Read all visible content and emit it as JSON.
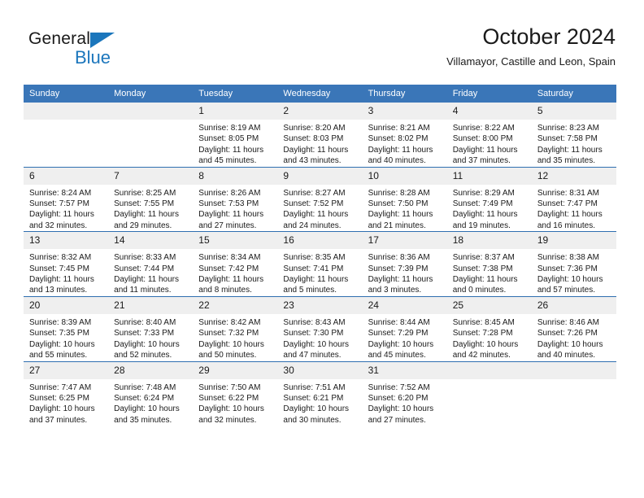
{
  "brand": {
    "name_top": "General",
    "name_bottom": "Blue",
    "accent_color": "#1b76bc"
  },
  "header": {
    "title": "October 2024",
    "subtitle": "Villamayor, Castille and Leon, Spain"
  },
  "calendar": {
    "header_bg": "#3a76b8",
    "daynum_bg": "#efefef",
    "grid_line_color": "#2f6fb0",
    "weekday_headers": [
      "Sunday",
      "Monday",
      "Tuesday",
      "Wednesday",
      "Thursday",
      "Friday",
      "Saturday"
    ],
    "weeks": [
      [
        {
          "day": ""
        },
        {
          "day": ""
        },
        {
          "day": "1",
          "sunrise": "Sunrise: 8:19 AM",
          "sunset": "Sunset: 8:05 PM",
          "daylight_l1": "Daylight: 11 hours",
          "daylight_l2": "and 45 minutes."
        },
        {
          "day": "2",
          "sunrise": "Sunrise: 8:20 AM",
          "sunset": "Sunset: 8:03 PM",
          "daylight_l1": "Daylight: 11 hours",
          "daylight_l2": "and 43 minutes."
        },
        {
          "day": "3",
          "sunrise": "Sunrise: 8:21 AM",
          "sunset": "Sunset: 8:02 PM",
          "daylight_l1": "Daylight: 11 hours",
          "daylight_l2": "and 40 minutes."
        },
        {
          "day": "4",
          "sunrise": "Sunrise: 8:22 AM",
          "sunset": "Sunset: 8:00 PM",
          "daylight_l1": "Daylight: 11 hours",
          "daylight_l2": "and 37 minutes."
        },
        {
          "day": "5",
          "sunrise": "Sunrise: 8:23 AM",
          "sunset": "Sunset: 7:58 PM",
          "daylight_l1": "Daylight: 11 hours",
          "daylight_l2": "and 35 minutes."
        }
      ],
      [
        {
          "day": "6",
          "sunrise": "Sunrise: 8:24 AM",
          "sunset": "Sunset: 7:57 PM",
          "daylight_l1": "Daylight: 11 hours",
          "daylight_l2": "and 32 minutes."
        },
        {
          "day": "7",
          "sunrise": "Sunrise: 8:25 AM",
          "sunset": "Sunset: 7:55 PM",
          "daylight_l1": "Daylight: 11 hours",
          "daylight_l2": "and 29 minutes."
        },
        {
          "day": "8",
          "sunrise": "Sunrise: 8:26 AM",
          "sunset": "Sunset: 7:53 PM",
          "daylight_l1": "Daylight: 11 hours",
          "daylight_l2": "and 27 minutes."
        },
        {
          "day": "9",
          "sunrise": "Sunrise: 8:27 AM",
          "sunset": "Sunset: 7:52 PM",
          "daylight_l1": "Daylight: 11 hours",
          "daylight_l2": "and 24 minutes."
        },
        {
          "day": "10",
          "sunrise": "Sunrise: 8:28 AM",
          "sunset": "Sunset: 7:50 PM",
          "daylight_l1": "Daylight: 11 hours",
          "daylight_l2": "and 21 minutes."
        },
        {
          "day": "11",
          "sunrise": "Sunrise: 8:29 AM",
          "sunset": "Sunset: 7:49 PM",
          "daylight_l1": "Daylight: 11 hours",
          "daylight_l2": "and 19 minutes."
        },
        {
          "day": "12",
          "sunrise": "Sunrise: 8:31 AM",
          "sunset": "Sunset: 7:47 PM",
          "daylight_l1": "Daylight: 11 hours",
          "daylight_l2": "and 16 minutes."
        }
      ],
      [
        {
          "day": "13",
          "sunrise": "Sunrise: 8:32 AM",
          "sunset": "Sunset: 7:45 PM",
          "daylight_l1": "Daylight: 11 hours",
          "daylight_l2": "and 13 minutes."
        },
        {
          "day": "14",
          "sunrise": "Sunrise: 8:33 AM",
          "sunset": "Sunset: 7:44 PM",
          "daylight_l1": "Daylight: 11 hours",
          "daylight_l2": "and 11 minutes."
        },
        {
          "day": "15",
          "sunrise": "Sunrise: 8:34 AM",
          "sunset": "Sunset: 7:42 PM",
          "daylight_l1": "Daylight: 11 hours",
          "daylight_l2": "and 8 minutes."
        },
        {
          "day": "16",
          "sunrise": "Sunrise: 8:35 AM",
          "sunset": "Sunset: 7:41 PM",
          "daylight_l1": "Daylight: 11 hours",
          "daylight_l2": "and 5 minutes."
        },
        {
          "day": "17",
          "sunrise": "Sunrise: 8:36 AM",
          "sunset": "Sunset: 7:39 PM",
          "daylight_l1": "Daylight: 11 hours",
          "daylight_l2": "and 3 minutes."
        },
        {
          "day": "18",
          "sunrise": "Sunrise: 8:37 AM",
          "sunset": "Sunset: 7:38 PM",
          "daylight_l1": "Daylight: 11 hours",
          "daylight_l2": "and 0 minutes."
        },
        {
          "day": "19",
          "sunrise": "Sunrise: 8:38 AM",
          "sunset": "Sunset: 7:36 PM",
          "daylight_l1": "Daylight: 10 hours",
          "daylight_l2": "and 57 minutes."
        }
      ],
      [
        {
          "day": "20",
          "sunrise": "Sunrise: 8:39 AM",
          "sunset": "Sunset: 7:35 PM",
          "daylight_l1": "Daylight: 10 hours",
          "daylight_l2": "and 55 minutes."
        },
        {
          "day": "21",
          "sunrise": "Sunrise: 8:40 AM",
          "sunset": "Sunset: 7:33 PM",
          "daylight_l1": "Daylight: 10 hours",
          "daylight_l2": "and 52 minutes."
        },
        {
          "day": "22",
          "sunrise": "Sunrise: 8:42 AM",
          "sunset": "Sunset: 7:32 PM",
          "daylight_l1": "Daylight: 10 hours",
          "daylight_l2": "and 50 minutes."
        },
        {
          "day": "23",
          "sunrise": "Sunrise: 8:43 AM",
          "sunset": "Sunset: 7:30 PM",
          "daylight_l1": "Daylight: 10 hours",
          "daylight_l2": "and 47 minutes."
        },
        {
          "day": "24",
          "sunrise": "Sunrise: 8:44 AM",
          "sunset": "Sunset: 7:29 PM",
          "daylight_l1": "Daylight: 10 hours",
          "daylight_l2": "and 45 minutes."
        },
        {
          "day": "25",
          "sunrise": "Sunrise: 8:45 AM",
          "sunset": "Sunset: 7:28 PM",
          "daylight_l1": "Daylight: 10 hours",
          "daylight_l2": "and 42 minutes."
        },
        {
          "day": "26",
          "sunrise": "Sunrise: 8:46 AM",
          "sunset": "Sunset: 7:26 PM",
          "daylight_l1": "Daylight: 10 hours",
          "daylight_l2": "and 40 minutes."
        }
      ],
      [
        {
          "day": "27",
          "sunrise": "Sunrise: 7:47 AM",
          "sunset": "Sunset: 6:25 PM",
          "daylight_l1": "Daylight: 10 hours",
          "daylight_l2": "and 37 minutes."
        },
        {
          "day": "28",
          "sunrise": "Sunrise: 7:48 AM",
          "sunset": "Sunset: 6:24 PM",
          "daylight_l1": "Daylight: 10 hours",
          "daylight_l2": "and 35 minutes."
        },
        {
          "day": "29",
          "sunrise": "Sunrise: 7:50 AM",
          "sunset": "Sunset: 6:22 PM",
          "daylight_l1": "Daylight: 10 hours",
          "daylight_l2": "and 32 minutes."
        },
        {
          "day": "30",
          "sunrise": "Sunrise: 7:51 AM",
          "sunset": "Sunset: 6:21 PM",
          "daylight_l1": "Daylight: 10 hours",
          "daylight_l2": "and 30 minutes."
        },
        {
          "day": "31",
          "sunrise": "Sunrise: 7:52 AM",
          "sunset": "Sunset: 6:20 PM",
          "daylight_l1": "Daylight: 10 hours",
          "daylight_l2": "and 27 minutes."
        },
        {
          "day": ""
        },
        {
          "day": ""
        }
      ]
    ]
  }
}
